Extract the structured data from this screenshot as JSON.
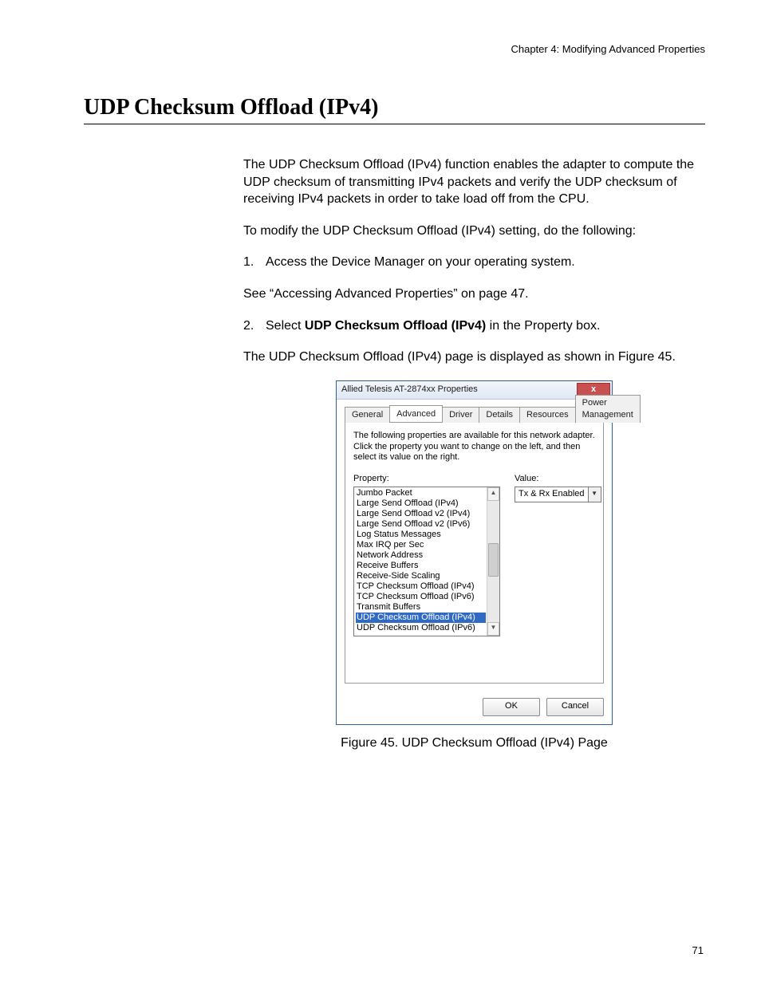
{
  "header": {
    "chapter": "Chapter 4: Modifying Advanced Properties"
  },
  "page_number": "71",
  "section": {
    "title": "UDP Checksum Offload (IPv4)",
    "intro": "The UDP Checksum Offload (IPv4) function enables the adapter to compute the UDP checksum of transmitting IPv4 packets and verify the UDP checksum of receiving IPv4 packets in order to take load off from the CPU.",
    "lead_in": "To modify the UDP Checksum Offload (IPv4) setting, do the following:",
    "step1_num": "1.",
    "step1": "Access the Device Manager on your operating system.",
    "step1_note": "See “Accessing Advanced Properties” on page 47.",
    "step2_num": "2.",
    "step2_pre": "Select ",
    "step2_bold": "UDP Checksum Offload (IPv4)",
    "step2_post": " in the Property box.",
    "step2_note": "The UDP Checksum Offload (IPv4) page is displayed as shown in Figure 45."
  },
  "figure": {
    "caption": "Figure 45. UDP Checksum Offload (IPv4) Page"
  },
  "dialog": {
    "title": "Allied Telesis AT-2874xx Properties",
    "close": "x",
    "tabs": {
      "general": "General",
      "advanced": "Advanced",
      "driver": "Driver",
      "details": "Details",
      "resources": "Resources",
      "power": "Power Management"
    },
    "description": "The following properties are available for this network adapter. Click the property you want to change on the left, and then select its value on the right.",
    "property_label": "Property:",
    "value_label": "Value:",
    "properties": [
      "Jumbo Packet",
      "Large Send Offload (IPv4)",
      "Large Send Offload v2 (IPv4)",
      "Large Send Offload v2 (IPv6)",
      "Log Status Messages",
      "Max IRQ per Sec",
      "Network Address",
      "Receive Buffers",
      "Receive-Side Scaling",
      "TCP Checksum Offload (IPv4)",
      "TCP Checksum Offload (IPv6)",
      "Transmit Buffers",
      "UDP Checksum Offload (IPv4)",
      "UDP Checksum Offload (IPv6)"
    ],
    "selected_index": 12,
    "value_selected": "Tx & Rx Enabled",
    "ok": "OK",
    "cancel": "Cancel"
  }
}
